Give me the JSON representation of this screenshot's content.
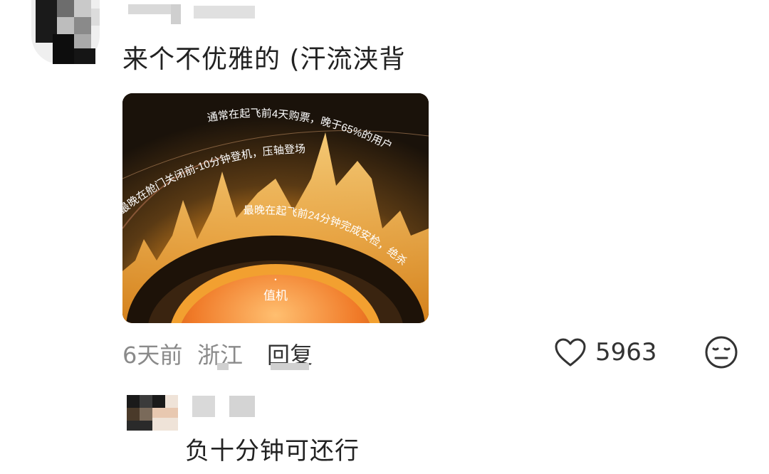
{
  "comment": {
    "text": "来个不优雅的 (汗流浃背",
    "time": "6天前",
    "location": "浙江",
    "reply_label": "回复",
    "like_count": "5963",
    "like_icon": "heart-outline-icon",
    "emoji_icon": "neutral-face-icon"
  },
  "image": {
    "label_center": "值机",
    "arc_text_1": "通常在起飞前4天购票，晚于65%的用户",
    "arc_text_2": "最晚在舱门关闭前-10分钟登机，压轴登场",
    "arc_text_3": "最晚在起飞前24分钟完成安检，绝杀"
  },
  "reply": {
    "text": "负十分钟可还行"
  },
  "colors": {
    "text": "#222222",
    "meta": "#8a8a8a",
    "accent_orange": "#f0a030"
  }
}
